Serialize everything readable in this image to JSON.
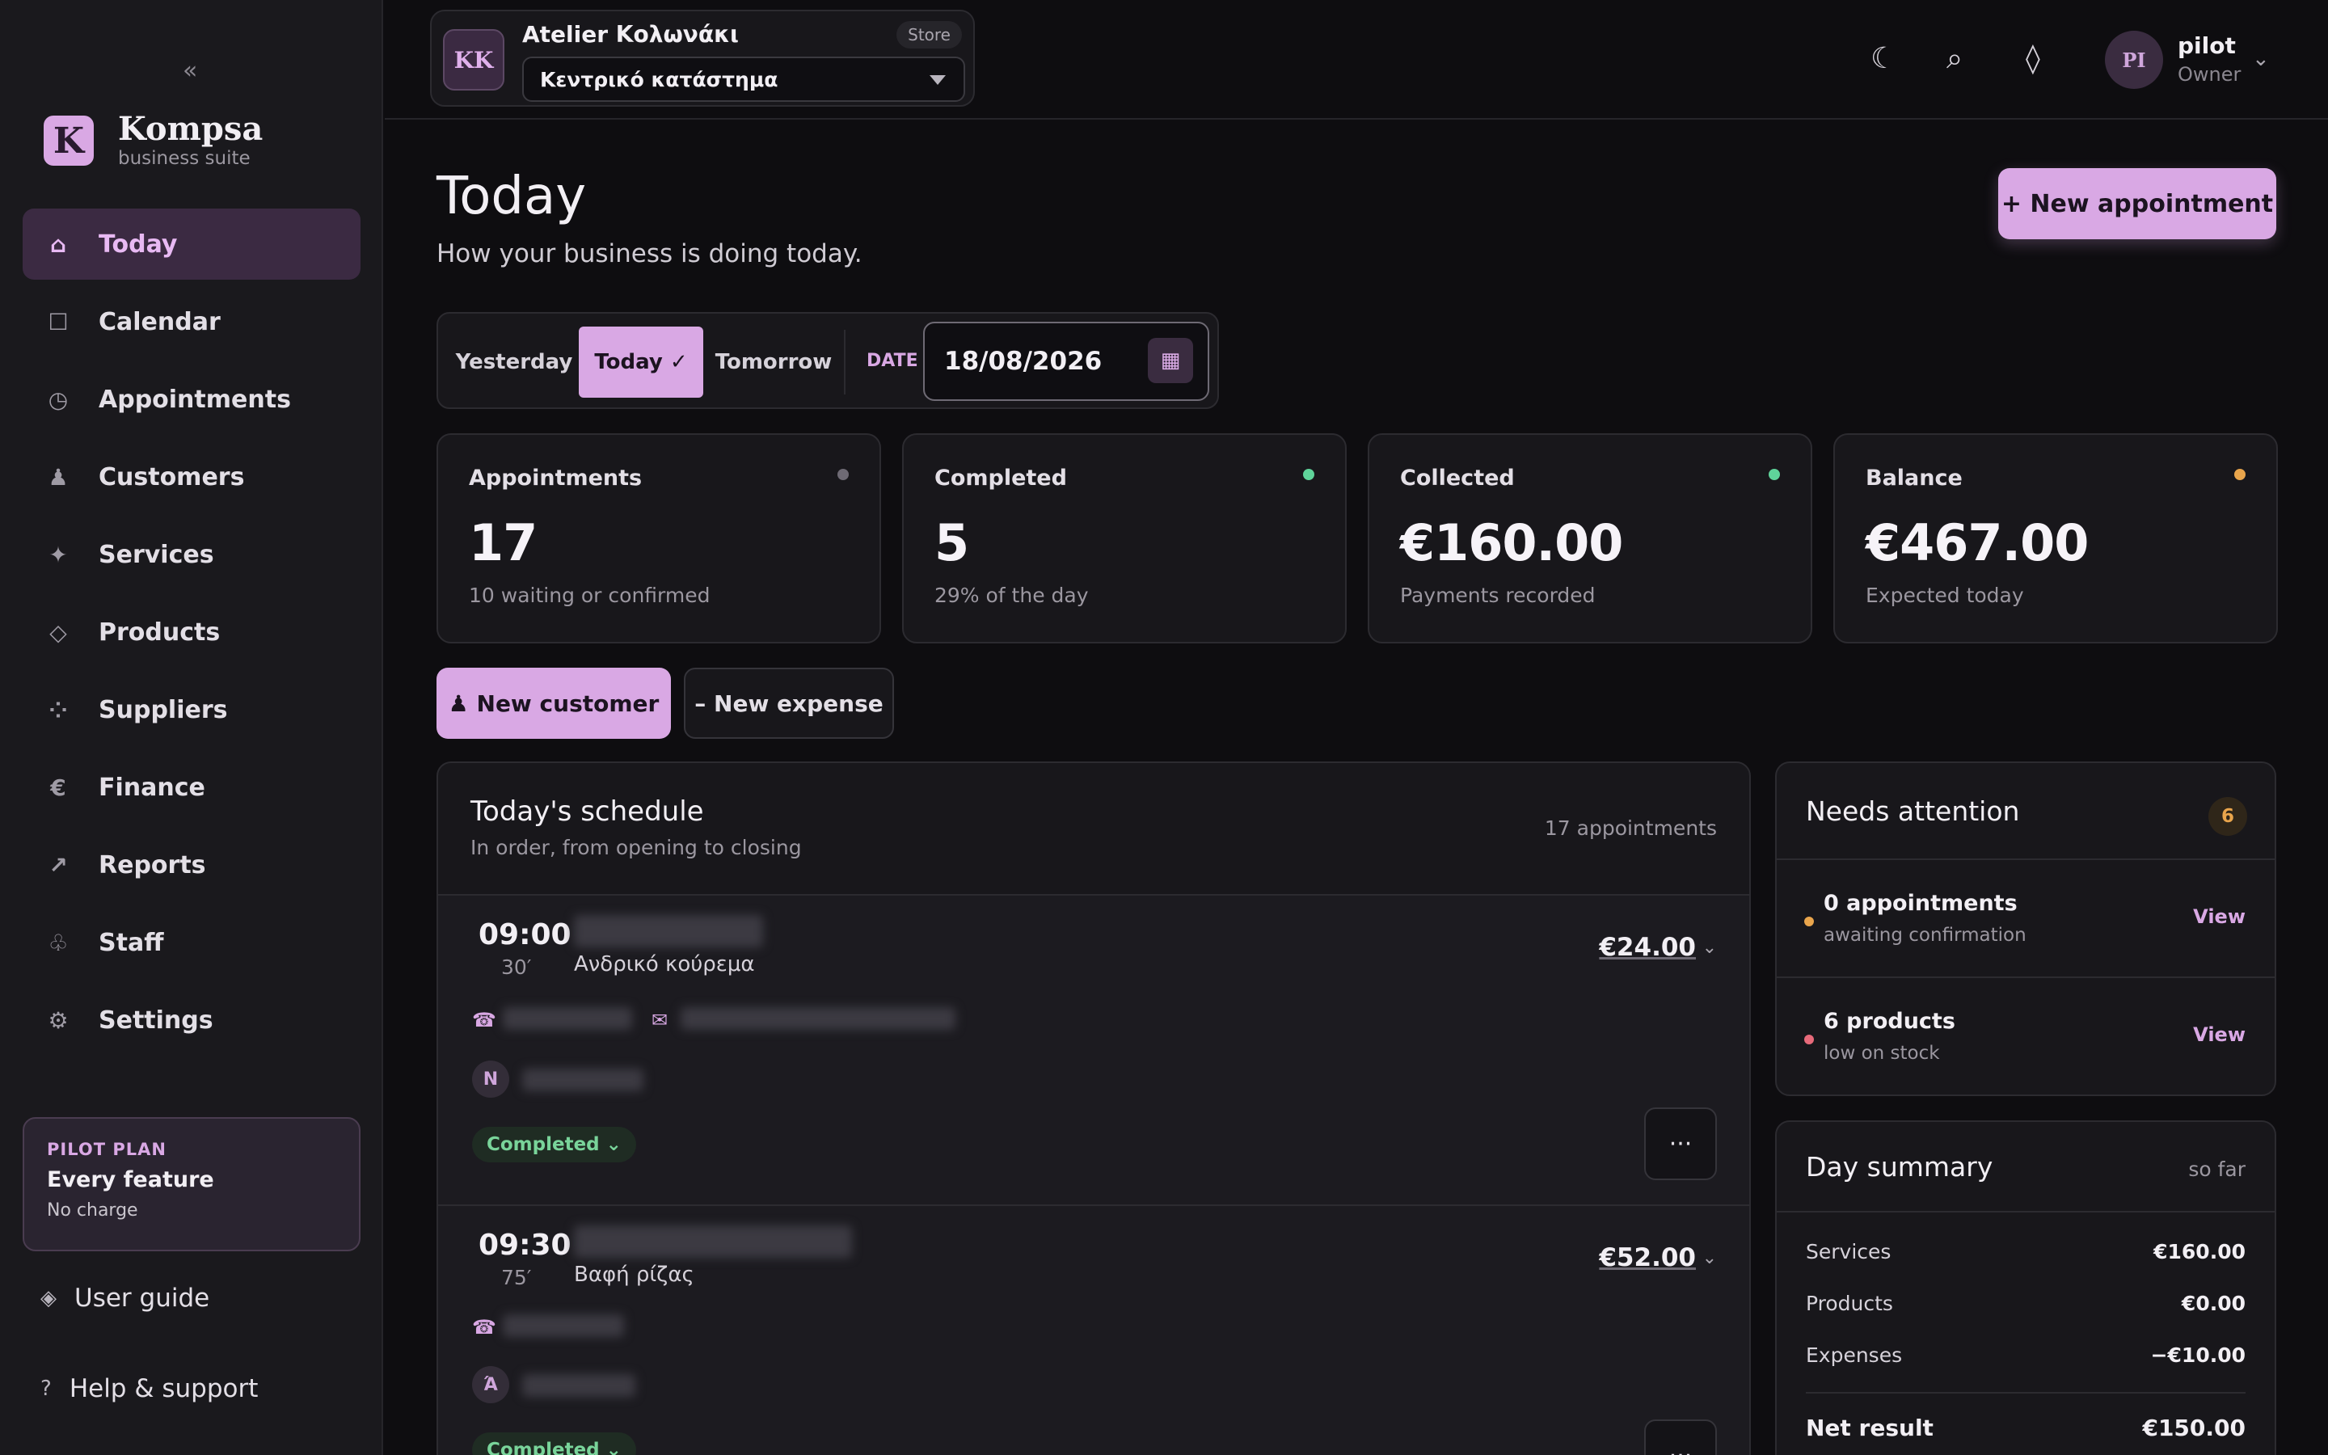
{
  "sidebar": {
    "collapse_glyph": "«",
    "brand": {
      "logo_letter": "K",
      "name": "Kompsa",
      "sub": "business suite"
    },
    "items": [
      {
        "label": "Today",
        "icon": "home-icon",
        "glyph": "⌂",
        "active": true
      },
      {
        "label": "Calendar",
        "icon": "calendar-icon",
        "glyph": "☐"
      },
      {
        "label": "Appointments",
        "icon": "clock-icon",
        "glyph": "◷"
      },
      {
        "label": "Customers",
        "icon": "customer-icon",
        "glyph": "♟"
      },
      {
        "label": "Services",
        "icon": "sparkle-icon",
        "glyph": "✦"
      },
      {
        "label": "Products",
        "icon": "diamond-icon",
        "glyph": "◇"
      },
      {
        "label": "Suppliers",
        "icon": "suppliers-icon",
        "glyph": "⁘"
      },
      {
        "label": "Finance",
        "icon": "euro-icon",
        "glyph": "€"
      },
      {
        "label": "Reports",
        "icon": "trend-icon",
        "glyph": "↗"
      },
      {
        "label": "Staff",
        "icon": "staff-icon",
        "glyph": "♧"
      },
      {
        "label": "Settings",
        "icon": "gear-icon",
        "glyph": "⚙"
      }
    ],
    "plan": {
      "tag": "PILOT PLAN",
      "title": "Every feature",
      "sub": "No charge"
    },
    "guide": {
      "label": "User guide",
      "glyph": "◈"
    },
    "help": {
      "label": "Help & support",
      "glyph": "?"
    }
  },
  "topbar": {
    "store": {
      "initials": "KK",
      "name": "Atelier Κολωνάκι",
      "badge": "Store",
      "branch": "Κεντρικό κατάστημα"
    },
    "icons": {
      "theme": "☾",
      "search": "⌕",
      "diamond": "◊"
    },
    "user": {
      "initials": "PI",
      "name": "pilot",
      "role": "Owner",
      "caret": "⌄"
    }
  },
  "main": {
    "title": "Today",
    "subtitle": "How your business is doing today.",
    "new_appointment": "+ New appointment",
    "day_switch": {
      "yesterday": "Yesterday",
      "today": "Today ✓",
      "tomorrow": "Tomorrow",
      "date_label": "DATE",
      "date_value": "18/08/2026",
      "cal_glyph": "▦"
    },
    "stats": [
      {
        "label": "Appointments",
        "value": "17",
        "sub": "10 waiting or confirmed",
        "dot_color": "#6e6a74"
      },
      {
        "label": "Completed",
        "value": "5",
        "sub": "29% of the day",
        "dot_color": "#5fd49a"
      },
      {
        "label": "Collected",
        "value": "€160.00",
        "sub": "Payments recorded",
        "dot_color": "#5fd49a"
      },
      {
        "label": "Balance",
        "value": "€467.00",
        "sub": "Expected today",
        "dot_color": "#e9a54c"
      }
    ],
    "new_customer": "♟  New customer",
    "new_expense": "–  New expense"
  },
  "schedule": {
    "title": "Today's schedule",
    "subtitle": "In order, from opening to closing",
    "count": "17 appointments",
    "appointments": [
      {
        "time": "09:00",
        "duration": "30′",
        "service": "Ανδρικό κούρεμα",
        "price": "€24.00",
        "staff_initial": "N",
        "status": "Completed ⌄",
        "more": "···"
      },
      {
        "time": "09:30",
        "duration": "75′",
        "service": "Βαφή ρίζας",
        "price": "€52.00",
        "staff_initial": "Ά",
        "status": "Completed ⌄",
        "more": "···"
      }
    ],
    "phone_glyph": "☎",
    "mail_glyph": "✉",
    "price_caret": "⌄"
  },
  "attention": {
    "title": "Needs attention",
    "count": "6",
    "rows": [
      {
        "main": "0 appointments",
        "sub": "awaiting confirmation",
        "link": "View",
        "dot_color": "#e9a54c"
      },
      {
        "main": "6 products",
        "sub": "low on stock",
        "link": "View",
        "dot_color": "#e76a7a"
      }
    ]
  },
  "summary": {
    "title": "Day summary",
    "note": "so far",
    "rows": [
      {
        "label": "Services",
        "value": "€160.00"
      },
      {
        "label": "Products",
        "value": "€0.00"
      },
      {
        "label": "Expenses",
        "value": "−€10.00"
      }
    ],
    "net": {
      "label": "Net result",
      "value": "€150.00"
    }
  }
}
